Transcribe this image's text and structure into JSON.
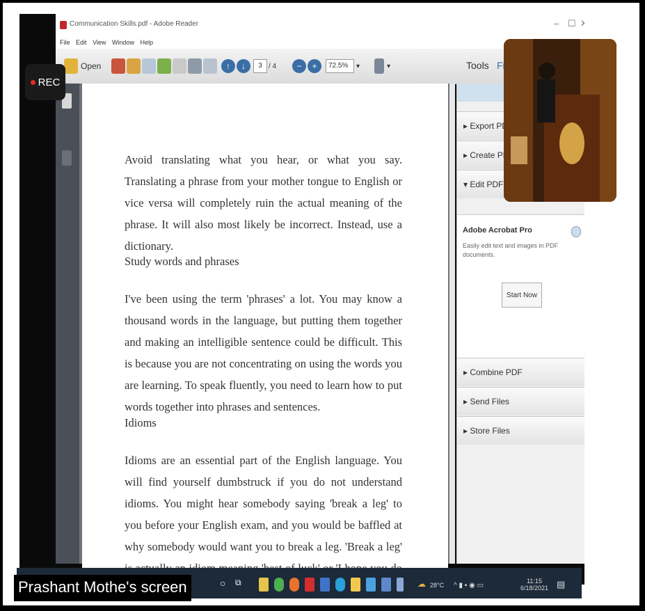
{
  "recording": {
    "label": "REC"
  },
  "window": {
    "title": "Communication Skills.pdf - Adobe Reader",
    "controls": [
      "–",
      "☐",
      "✕"
    ]
  },
  "menu": [
    "File",
    "Edit",
    "View",
    "Window",
    "Help"
  ],
  "toolbar": {
    "open_label": "Open",
    "page_current": "3",
    "page_total": "/ 4",
    "zoom_value": "72.5%",
    "tools_label": "Tools",
    "fill_label": "Fill"
  },
  "document": {
    "paragraphs": [
      "Avoid translating what you hear, or what you say. Translating a phrase from your mother tongue to English or vice versa will completely ruin the actual meaning of the phrase. It will also most likely be incorrect. Instead, use a dictionary.",
      "Study words and phrases",
      "I've been using the term 'phrases' a lot. You may know a thousand words in the language, but putting them together and making an intelligible sentence could be difficult. This is because you are not concentrating on using the words you are learning. To speak fluently, you need to learn how to put words together into phrases and sentences.",
      "Idioms",
      "Idioms are an essential part of the English language. You will find yourself dumbstruck if you do not understand idioms. You might hear somebody saying 'break a leg' to you before your English exam, and you would be baffled at why somebody would want you to break a leg. 'Break a leg' is actually an idiom meaning 'best of luck' or 'I hope you do well.' There are"
    ]
  },
  "right_panel": {
    "sections_top": [
      "▸ Export PDF",
      "▸ Create PDF",
      "▾ Edit PDF"
    ],
    "promo_title": "Adobe Acrobat Pro",
    "promo_desc": "Easily edit text and images in PDF documents.",
    "promo_button": "Start Now",
    "sections_bottom": [
      "▸ Combine PDF",
      "▸ Send Files",
      "▸ Store Files"
    ]
  },
  "share": {
    "screen_label": "Prashant Mothe's screen"
  },
  "taskbar": {
    "weather": "28°C",
    "time": "11:15",
    "date": "6/18/2021"
  }
}
